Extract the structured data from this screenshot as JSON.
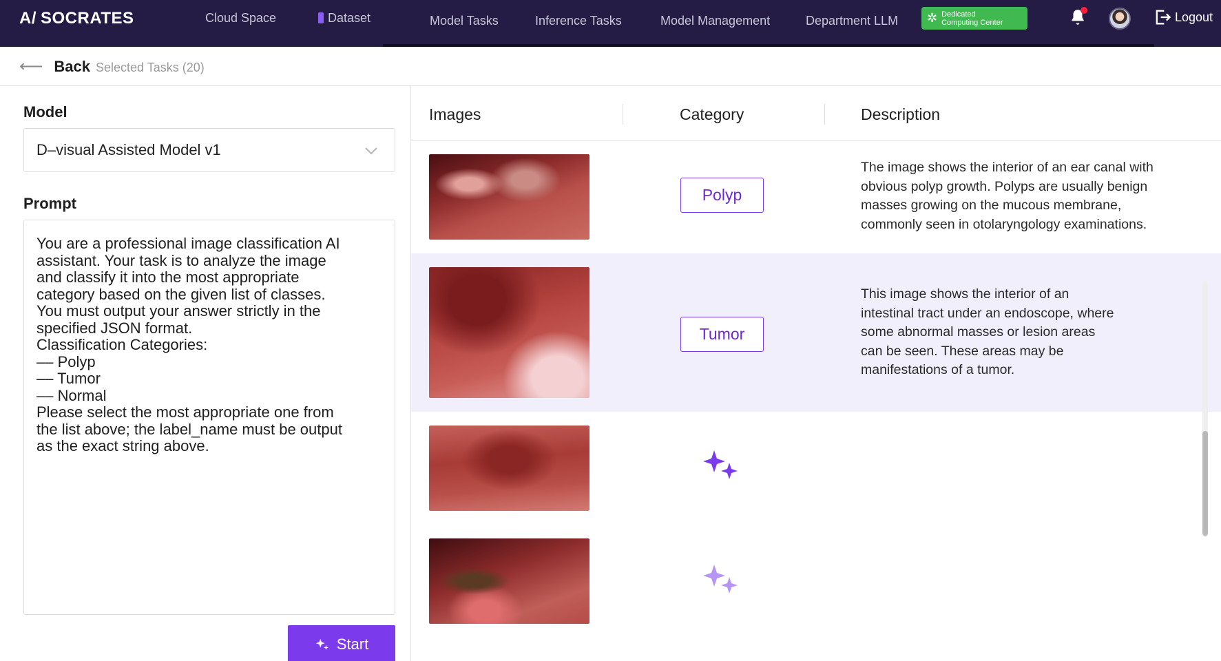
{
  "app": {
    "logo": "SOCRATES",
    "logo_mark": "A/"
  },
  "nav": {
    "items": [
      {
        "label": "Cloud Space"
      },
      {
        "label": "Dataset"
      },
      {
        "label": "Model Tasks"
      },
      {
        "label": "Inference Tasks"
      },
      {
        "label": "Model Management"
      },
      {
        "label": "Department LLM"
      }
    ],
    "active_item": "Dataset",
    "dedicated_line1": "Dedicated",
    "dedicated_line2": "Computing Center",
    "logout": "Logout"
  },
  "subheader": {
    "back": "Back",
    "selected": "Selected Tasks (20)"
  },
  "left": {
    "model_label": "Model",
    "model_value": "D–visual Assisted Model v1",
    "prompt_label": "Prompt",
    "prompt_text": "You are a professional image classification AI\nassistant. Your task is to analyze the image\nand classify it into the most appropriate\ncategory based on the given list of classes.\nYou must output your answer strictly in the\nspecified JSON format.\nClassification Categories:\n–– Polyp\n–– Tumor\n–– Normal\nPlease select the most appropriate one from\nthe list above; the label_name must be output\nas the exact string above.",
    "start": "Start"
  },
  "table": {
    "headers": {
      "images": "Images",
      "category": "Category",
      "description": "Description"
    },
    "rows": [
      {
        "category": "Polyp",
        "description": "The image shows the interior of an ear canal with obvious polyp growth. Polyps are usually benign masses growing on the mucous membrane, commonly seen in otolaryngology examinations.",
        "status": "done"
      },
      {
        "category": "Tumor",
        "description": "This image shows the interior of an intestinal tract under an endoscope, where some abnormal masses or lesion areas can be seen. These areas may be manifestations of a tumor.",
        "status": "done"
      },
      {
        "category": "",
        "description": "",
        "status": "processing"
      },
      {
        "category": "",
        "description": "",
        "status": "pending"
      }
    ]
  },
  "colors": {
    "accent": "#7c3aed",
    "nav_bg": "#241c44",
    "highlight_row": "#f2effd",
    "badge_green": "#3fb950",
    "notification": "#ff1f3d"
  },
  "icons": [
    "arrow-left-icon",
    "chevron-down-icon",
    "sparkle-icon",
    "bell-icon",
    "logout-icon",
    "gear-icon"
  ]
}
